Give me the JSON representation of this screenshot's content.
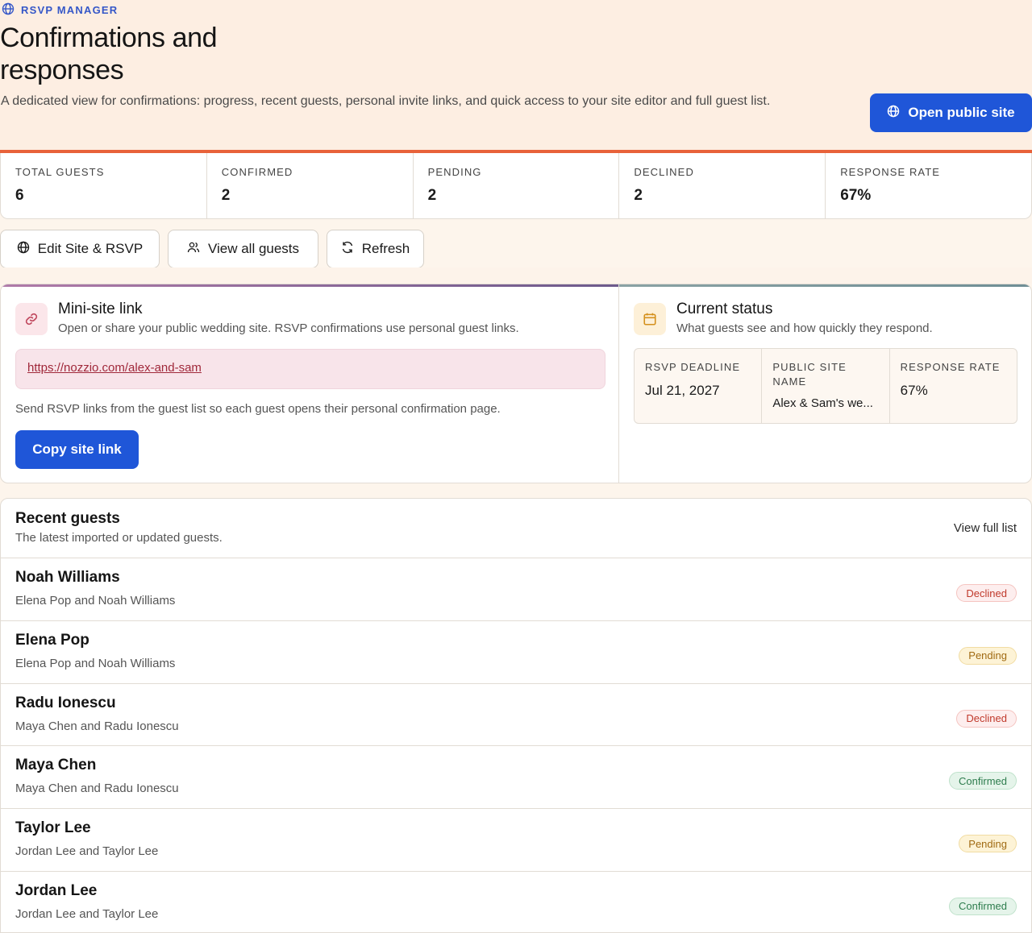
{
  "colors": {
    "accent": "#e8623a",
    "primary": "#1f56d8",
    "declined": "#c0392b",
    "pending": "#a06a12",
    "confirmed": "#2e7d4e"
  },
  "header": {
    "eyebrow": "RSVP MANAGER",
    "title": "Confirmations and responses",
    "subtitle": "A dedicated view for confirmations: progress, recent guests, personal invite links, and quick access to your site editor and full guest list.",
    "open_site_label": "Open public site"
  },
  "stats": [
    {
      "label": "TOTAL GUESTS",
      "value": "6"
    },
    {
      "label": "CONFIRMED",
      "value": "2"
    },
    {
      "label": "PENDING",
      "value": "2"
    },
    {
      "label": "DECLINED",
      "value": "2"
    },
    {
      "label": "RESPONSE RATE",
      "value": "67%"
    }
  ],
  "actions": {
    "edit": "Edit Site & RSVP",
    "view_guests": "View all guests",
    "refresh": "Refresh"
  },
  "minisite": {
    "title": "Mini-site link",
    "subtitle": "Open or share your public wedding site. RSVP confirmations use personal guest links.",
    "url": "https://nozzio.com/alex-and-sam",
    "help": "Send RSVP links from the guest list so each guest opens their personal confirmation page.",
    "copy_label": "Copy site link"
  },
  "status": {
    "title": "Current status",
    "subtitle": "What guests see and how quickly they respond.",
    "deadline_label": "RSVP DEADLINE",
    "deadline_value": "Jul 21, 2027",
    "site_name_label": "PUBLIC SITE NAME",
    "site_name_value": "Alex & Sam's we...",
    "rate_label": "RESPONSE RATE",
    "rate_value": "67%"
  },
  "recent": {
    "title": "Recent guests",
    "subtitle": "The latest imported or updated guests.",
    "view_full": "View full list",
    "guests": [
      {
        "name": "Noah Williams",
        "party": "Elena Pop and Noah Williams",
        "status": "Declined"
      },
      {
        "name": "Elena Pop",
        "party": "Elena Pop and Noah Williams",
        "status": "Pending"
      },
      {
        "name": "Radu Ionescu",
        "party": "Maya Chen and Radu Ionescu",
        "status": "Declined"
      },
      {
        "name": "Maya Chen",
        "party": "Maya Chen and Radu Ionescu",
        "status": "Confirmed"
      },
      {
        "name": "Taylor Lee",
        "party": "Jordan Lee and Taylor Lee",
        "status": "Pending"
      },
      {
        "name": "Jordan Lee",
        "party": "Jordan Lee and Taylor Lee",
        "status": "Confirmed"
      }
    ]
  }
}
